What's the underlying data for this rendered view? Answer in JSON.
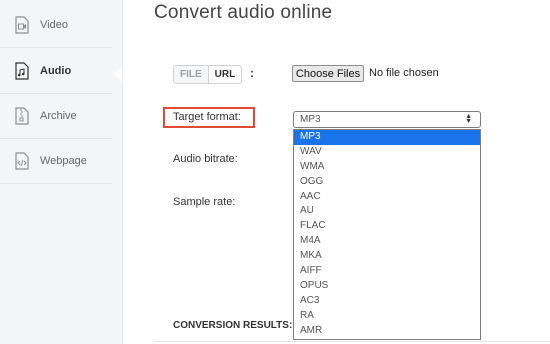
{
  "sidebar": {
    "items": [
      {
        "label": "Video",
        "icon": "video-file-icon"
      },
      {
        "label": "Audio",
        "icon": "audio-file-icon",
        "active": true
      },
      {
        "label": "Archive",
        "icon": "archive-file-icon"
      },
      {
        "label": "Webpage",
        "icon": "code-file-icon"
      }
    ]
  },
  "main": {
    "title": "Convert audio online",
    "source_toggle": {
      "file_label": "FILE",
      "url_label": "URL",
      "separator": ":"
    },
    "file_input": {
      "button_label": "Choose Files",
      "status_text": "No file chosen"
    },
    "target_format": {
      "label": "Target format:",
      "selected": "MP3",
      "options": [
        "MP3",
        "WAV",
        "WMA",
        "OGG",
        "AAC",
        "AU",
        "FLAC",
        "M4A",
        "MKA",
        "AIFF",
        "OPUS",
        "AC3",
        "RA",
        "AMR"
      ]
    },
    "audio_bitrate_label": "Audio bitrate:",
    "sample_rate_label": "Sample rate:",
    "results_label": "CONVERSION RESULTS:"
  },
  "colors": {
    "highlight_border": "#e34a33",
    "selected_option": "#1a73e8"
  }
}
